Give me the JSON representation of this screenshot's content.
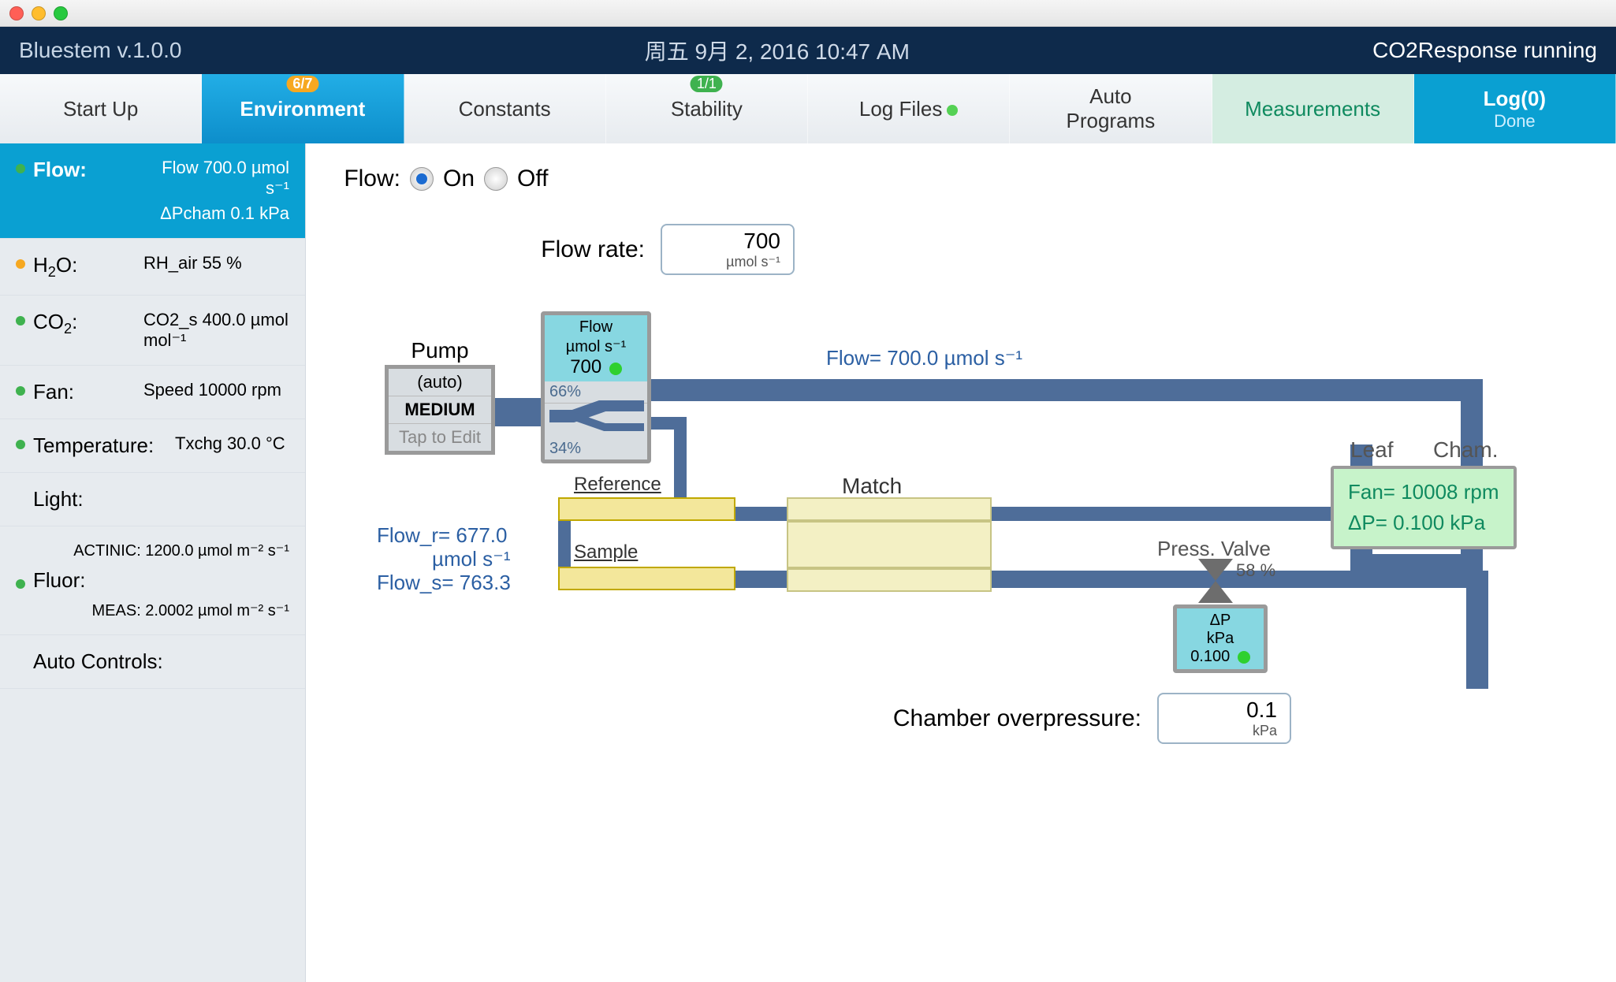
{
  "statusbar": {
    "app": "Bluestem v.1.0.0",
    "time": "周五 9月 2, 2016 10:47 AM",
    "state": "CO2Response running"
  },
  "tabs": {
    "startup": "Start Up",
    "env": "Environment",
    "env_badge": "6/7",
    "constants": "Constants",
    "stability": "Stability",
    "stability_badge": "1/1",
    "logfiles": "Log Files",
    "autoprograms_l1": "Auto",
    "autoprograms_l2": "Programs",
    "measurements": "Measurements",
    "log_l1": "Log(0)",
    "log_l2": "Done"
  },
  "sidebar": {
    "flow": {
      "label": "Flow:",
      "r1": "Flow 700.0 µmol s⁻¹",
      "r2": "ΔPcham 0.1 kPa"
    },
    "h2o": {
      "label": "H₂O:",
      "val": "RH_air 55 %"
    },
    "co2": {
      "label": "CO₂:",
      "val": "CO2_s 400.0 µmol mol⁻¹"
    },
    "fan": {
      "label": "Fan:",
      "val": "Speed 10000 rpm"
    },
    "temp": {
      "label": "Temperature:",
      "val": "Txchg 30.0 °C"
    },
    "light": {
      "label": "Light:",
      "val": ""
    },
    "fluor": {
      "label": "Fluor:",
      "r1": "ACTINIC: 1200.0 µmol m⁻² s⁻¹",
      "r2": "MEAS: 2.0002 µmol m⁻² s⁻¹"
    },
    "auto": {
      "label": "Auto Controls:"
    }
  },
  "content": {
    "flow_label": "Flow:",
    "on": "On",
    "off": "Off",
    "flow_rate_label": "Flow rate:",
    "flow_rate_val": "700",
    "flow_rate_unit": "µmol s⁻¹",
    "chamber_op_label": "Chamber overpressure:",
    "chamber_op_val": "0.1",
    "chamber_op_unit": "kPa"
  },
  "diagram": {
    "pump_hdr": "Pump",
    "pump_auto": "(auto)",
    "pump_speed": "MEDIUM",
    "pump_edit": "Tap to Edit",
    "flowbox_l1": "Flow",
    "flowbox_l2": "µmol s⁻¹",
    "flowbox_val": "700",
    "flowbox_pct_top": "66%",
    "flowbox_pct_bot": "34%",
    "flow_line": "Flow= 700.0 µmol s⁻¹",
    "ref_label": "Reference",
    "sample_label": "Sample",
    "flow_r": "Flow_r= 677.0",
    "flow_unit": "µmol s⁻¹",
    "flow_s": "Flow_s= 763.3",
    "match_label": "Match",
    "press_valve": "Press. Valve",
    "press_valve_pct": "58 %",
    "leaf": "Leaf",
    "cham": "Cham.",
    "chamber_fan": "Fan= 10008 rpm",
    "chamber_dp": "ΔP= 0.100 kPa",
    "dpbox_l1": "ΔP",
    "dpbox_l2": "kPa",
    "dpbox_val": "0.100"
  }
}
